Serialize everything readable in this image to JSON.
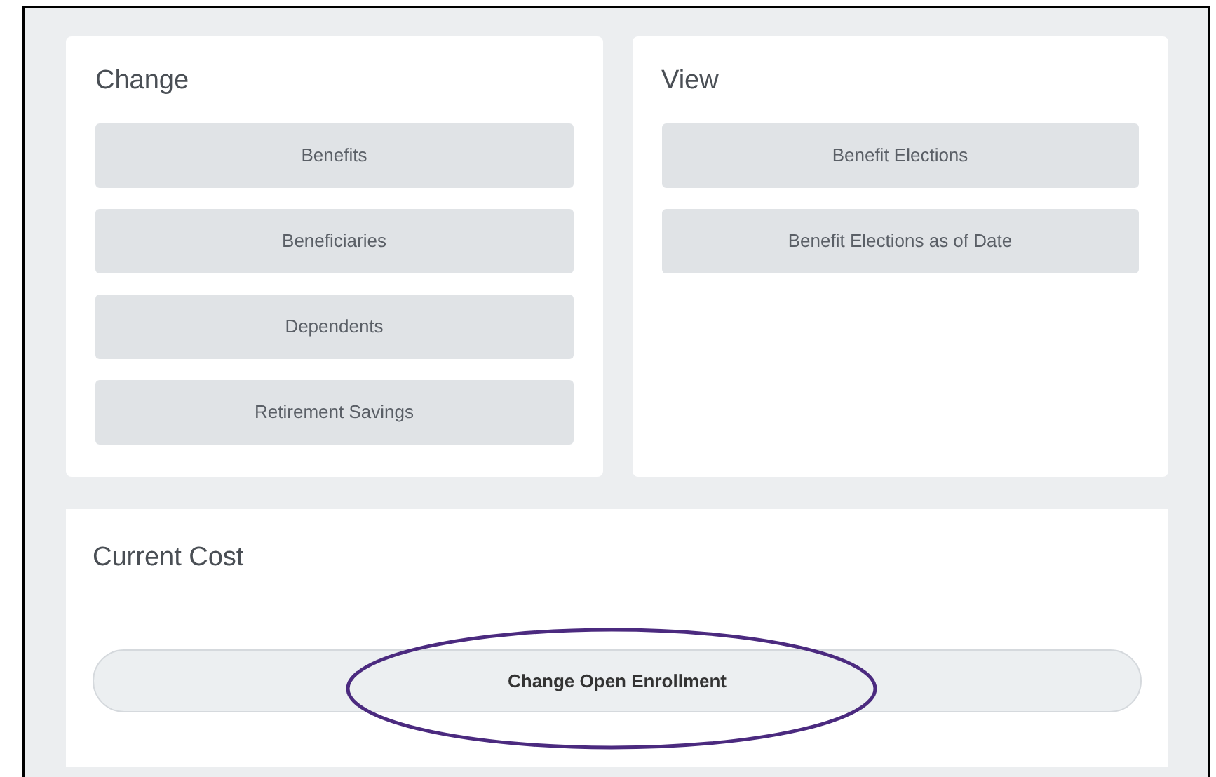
{
  "change": {
    "title": "Change",
    "buttons": [
      "Benefits",
      "Beneficiaries",
      "Dependents",
      "Retirement Savings"
    ]
  },
  "view": {
    "title": "View",
    "buttons": [
      "Benefit Elections",
      "Benefit Elections as of Date"
    ]
  },
  "current_cost": {
    "title": "Current Cost",
    "button": "Change Open Enrollment"
  }
}
